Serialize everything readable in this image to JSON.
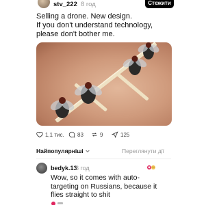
{
  "post": {
    "username": "stv_222",
    "time": "8 год",
    "follow_label": "Стежити",
    "text_lines": [
      "Selling a drone. New design.",
      "If you don't understand technology,",
      "please don't bother me."
    ],
    "image_alt_icon": "photo-flies-on-matchsticks"
  },
  "actions": {
    "likes": "1,1 тис.",
    "comments": "83",
    "reposts": "9",
    "shares": "125"
  },
  "comments_header": {
    "sort_label": "Найпопулярніші",
    "view_all_label": "Переглянути дії"
  },
  "comment": {
    "username": "bedyk.13",
    "time": "8 год",
    "text_lines": [
      "Wow, so it comes with auto-",
      "targeting on Russians, because it",
      "flies straight to shit"
    ]
  },
  "colors": {
    "accent_black": "#000000",
    "muted_gray": "#9a9a9a",
    "reaction_red": "#e0245e"
  }
}
